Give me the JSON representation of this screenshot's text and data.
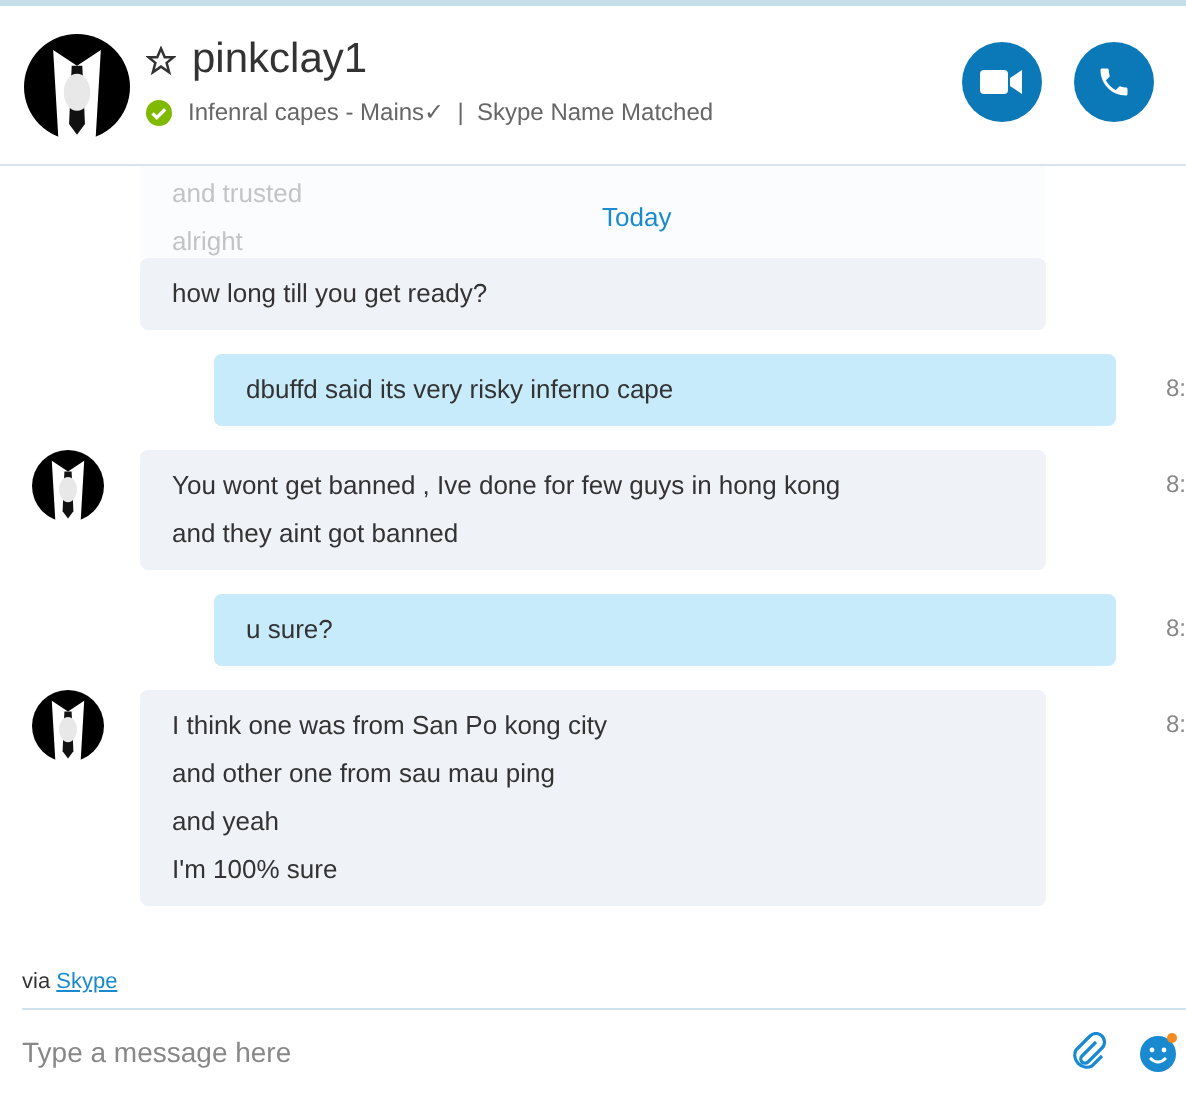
{
  "header": {
    "name": "pinkclay1",
    "favorite": false,
    "online": true,
    "status_text": "Infenral capes - Mains✓  |  Skype Name Matched",
    "buttons": [
      {
        "kind": "video"
      },
      {
        "kind": "call"
      }
    ]
  },
  "date_label": "Today",
  "messages": [
    {
      "kind": "incoming",
      "avatar": false,
      "faded": true,
      "lines": [
        "and trusted",
        "alright"
      ]
    },
    {
      "kind": "incoming",
      "avatar": false,
      "faded": false,
      "lines": [
        "how long till you get ready?"
      ]
    },
    {
      "kind": "outgoing",
      "faded": false,
      "time": "8:",
      "lines": [
        "dbuffd said its very risky inferno cape"
      ]
    },
    {
      "kind": "incoming",
      "avatar": true,
      "faded": false,
      "time": "8:",
      "lines": [
        "You wont get banned , Ive done for few guys in hong kong",
        "and they aint got banned"
      ]
    },
    {
      "kind": "outgoing",
      "faded": false,
      "time": "8:",
      "lines": [
        "u sure?"
      ]
    },
    {
      "kind": "incoming",
      "avatar": true,
      "faded": false,
      "time": "8:",
      "lines": [
        "I think one was from San Po kong city",
        "and other one from sau mau ping",
        "and yeah",
        "I'm 100% sure"
      ]
    }
  ],
  "via": {
    "prefix": "via",
    "link": "Skype"
  },
  "composer": {
    "placeholder": "Type a message here"
  }
}
